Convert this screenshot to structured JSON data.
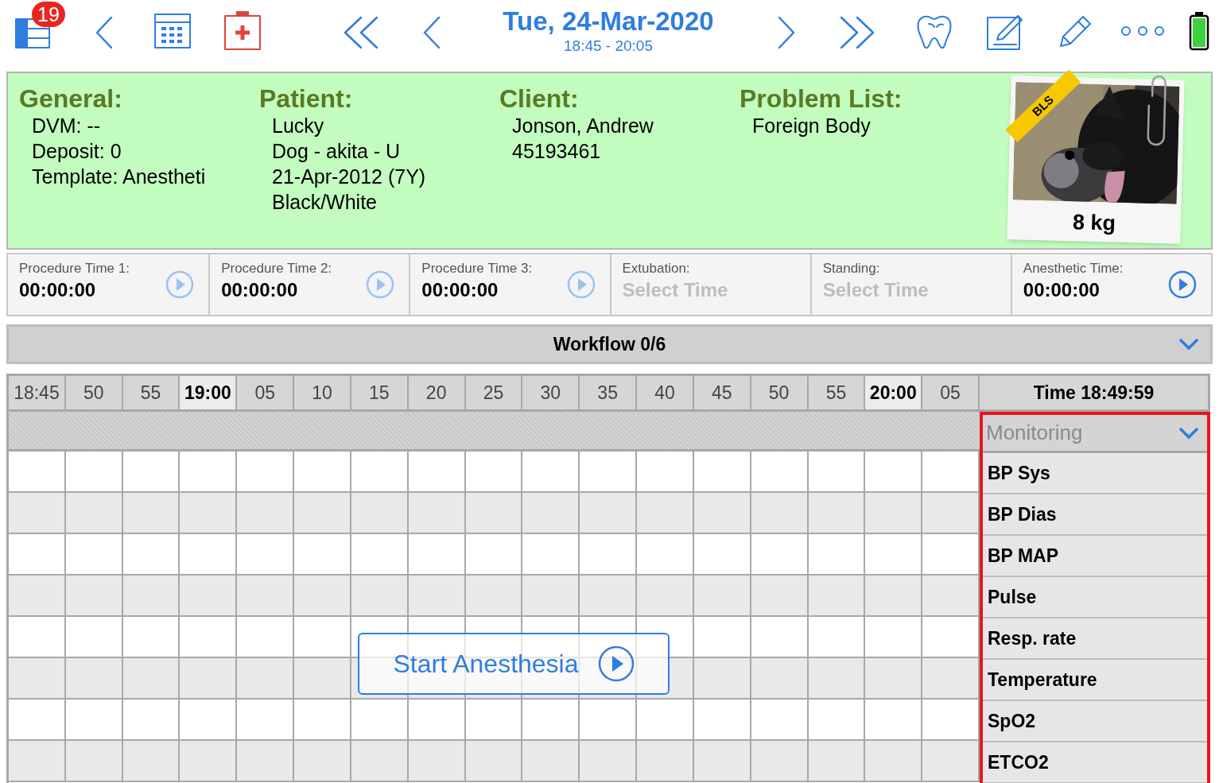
{
  "toolbar": {
    "badge": "19",
    "date": "Tue, 24-Mar-2020",
    "time_range": "18:45 - 20:05"
  },
  "general": {
    "title": "General:",
    "lines": [
      "DVM: --",
      "Deposit: 0",
      "Template: Anestheti"
    ]
  },
  "patient": {
    "title": "Patient:",
    "lines": [
      "Lucky",
      "Dog - akita - U",
      "21-Apr-2012 (7Y)",
      "Black/White"
    ]
  },
  "client": {
    "title": "Client:",
    "lines": [
      "Jonson, Andrew",
      "45193461"
    ]
  },
  "problem_list": {
    "title": "Problem List:",
    "lines": [
      "Foreign Body"
    ]
  },
  "photo": {
    "kind": "picture",
    "ribbon": "BLS",
    "weight": "8 kg"
  },
  "timers": [
    {
      "label": "Procedure Time 1:",
      "value": "00:00:00",
      "kind": "time"
    },
    {
      "label": "Procedure Time 2:",
      "value": "00:00:00",
      "kind": "time"
    },
    {
      "label": "Procedure Time 3:",
      "value": "00:00:00",
      "kind": "time"
    },
    {
      "label": "Extubation:",
      "value": "Select Time",
      "kind": "select"
    },
    {
      "label": "Standing:",
      "value": "Select Time",
      "kind": "select"
    },
    {
      "label": "Anesthetic Time:",
      "value": "00:00:00",
      "kind": "time"
    }
  ],
  "workflow": {
    "label": "Workflow 0/6"
  },
  "timeline": {
    "columns": [
      {
        "label": "18:45",
        "hour": false
      },
      {
        "label": "50",
        "hour": false
      },
      {
        "label": "55",
        "hour": false
      },
      {
        "label": "19:00",
        "hour": true
      },
      {
        "label": "05",
        "hour": false
      },
      {
        "label": "10",
        "hour": false
      },
      {
        "label": "15",
        "hour": false
      },
      {
        "label": "20",
        "hour": false
      },
      {
        "label": "25",
        "hour": false
      },
      {
        "label": "30",
        "hour": false
      },
      {
        "label": "35",
        "hour": false
      },
      {
        "label": "40",
        "hour": false
      },
      {
        "label": "45",
        "hour": false
      },
      {
        "label": "50",
        "hour": false
      },
      {
        "label": "55",
        "hour": false
      },
      {
        "label": "20:00",
        "hour": true
      },
      {
        "label": "05",
        "hour": false
      }
    ],
    "current_time": "Time 18:49:59"
  },
  "monitoring": {
    "title": "Monitoring",
    "highlighted": true,
    "parameters": [
      "BP Sys",
      "BP Dias",
      "BP MAP",
      "Pulse",
      "Resp. rate",
      "Temperature",
      "SpO2",
      "ETCO2"
    ]
  },
  "start_button": "Start Anesthesia"
}
